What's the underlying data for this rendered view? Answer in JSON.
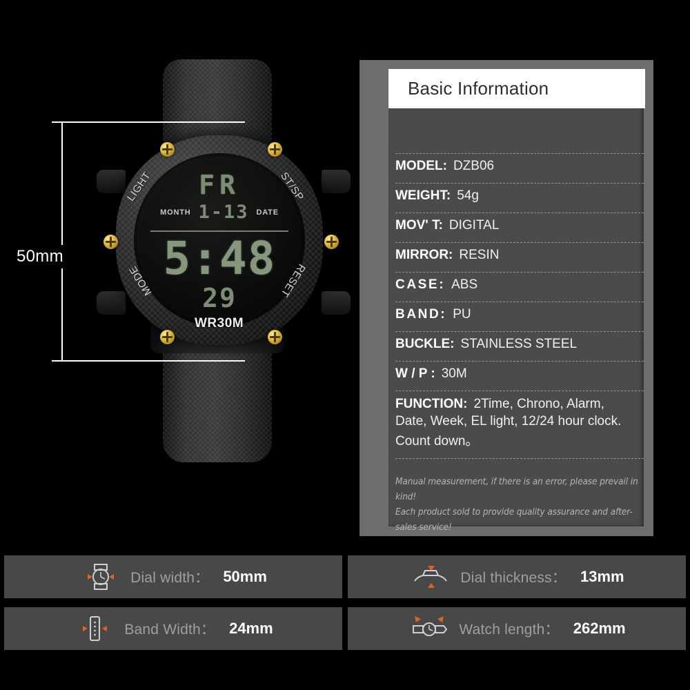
{
  "watch": {
    "dimension_label": "50mm",
    "lcd": {
      "day": "FR",
      "month_tag": "MONTH",
      "date_tag": "DATE",
      "date": "1-13",
      "time": "5:48",
      "seconds": "29"
    },
    "bezel": {
      "light": "LIGHT",
      "stsp": "ST/SP",
      "mode": "MODE",
      "reset": "RESET",
      "water_resist": "WR30M"
    }
  },
  "info": {
    "header_title": "Basic Information",
    "specs": [
      {
        "key": "MODEL:",
        "value": "DZB06",
        "spaced": false
      },
      {
        "key": "WEIGHT:",
        "value": "54g",
        "spaced": false
      },
      {
        "key": "MOV' T:",
        "value": "DIGITAL",
        "spaced": false
      },
      {
        "key": "MIRROR:",
        "value": "RESIN",
        "spaced": false
      },
      {
        "key": "CASE:",
        "value": "ABS",
        "spaced": true
      },
      {
        "key": "BAND:",
        "value": "PU",
        "spaced": true
      },
      {
        "key": "BUCKLE:",
        "value": "STAINLESS STEEL",
        "spaced": false
      },
      {
        "key": "W / P :",
        "value": "30M",
        "spaced": false
      }
    ],
    "function": {
      "key": "FUNCTION:",
      "line1": "2Time, Chrono,  Alarm,",
      "line2": "Date,  Week,  EL light,  12/24 hour clock.",
      "line3": "Count down。"
    },
    "disclaimer_line1": "Manual measurement, if there is an error, please prevail in kind!",
    "disclaimer_line2": "Each product sold to provide quality assurance and after-sales service!"
  },
  "bottom_bars": [
    {
      "icon": "watch-face-width-icon",
      "label": "Dial width：",
      "value": "50mm"
    },
    {
      "icon": "watch-side-thickness-icon",
      "label": "Dial thickness：",
      "value": "13mm"
    },
    {
      "icon": "strap-width-icon",
      "label": "Band Width：",
      "value": "24mm"
    },
    {
      "icon": "watch-length-icon",
      "label": "Watch length：",
      "value": "262mm"
    }
  ],
  "colors": {
    "background": "#000000",
    "panel_outer": "#6d6d6d",
    "panel_inner": "#4b4b4b",
    "header_bg": "#ffffff",
    "bar_bg": "#484848",
    "accent_orange": "#e2622a",
    "lcd_green": "#87977d"
  }
}
